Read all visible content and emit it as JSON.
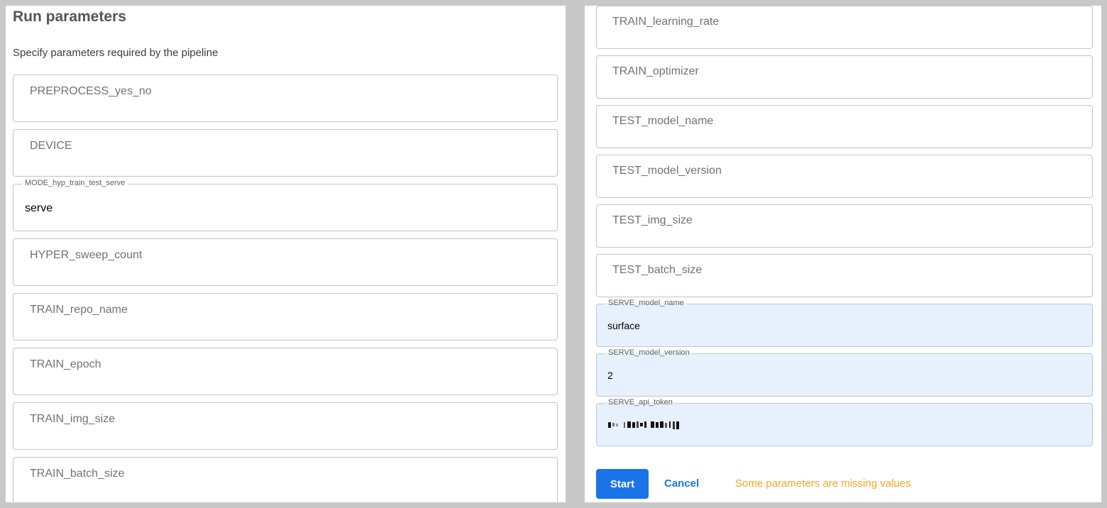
{
  "dialog": {
    "title": "Run parameters",
    "subtitle": "Specify parameters required by the pipeline"
  },
  "left_fields": [
    {
      "label": "PREPROCESS_yes_no",
      "value": ""
    },
    {
      "label": "DEVICE",
      "value": ""
    },
    {
      "label": "MODE_hyp_train_test_serve",
      "value": "serve"
    },
    {
      "label": "HYPER_sweep_count",
      "value": ""
    },
    {
      "label": "TRAIN_repo_name",
      "value": ""
    },
    {
      "label": "TRAIN_epoch",
      "value": ""
    },
    {
      "label": "TRAIN_img_size",
      "value": ""
    },
    {
      "label": "TRAIN_batch_size",
      "value": ""
    }
  ],
  "right_fields": [
    {
      "label": "TRAIN_learning_rate",
      "value": ""
    },
    {
      "label": "TRAIN_optimizer",
      "value": ""
    },
    {
      "label": "TEST_model_name",
      "value": ""
    },
    {
      "label": "TEST_model_version",
      "value": ""
    },
    {
      "label": "TEST_img_size",
      "value": ""
    },
    {
      "label": "TEST_batch_size",
      "value": ""
    },
    {
      "label": "SERVE_model_name",
      "value": "surface"
    },
    {
      "label": "SERVE_model_version",
      "value": "2"
    },
    {
      "label": "SERVE_api_token",
      "value": ""
    }
  ],
  "actions": {
    "start_label": "Start",
    "cancel_label": "Cancel",
    "status_message": "Some parameters are missing values"
  },
  "colors": {
    "primary": "#1a73e8",
    "warning": "#f5a623",
    "autofill_bg": "#e7f0fd"
  }
}
